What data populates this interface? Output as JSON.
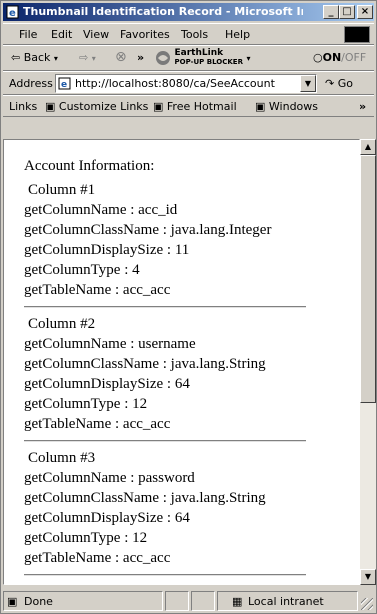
{
  "window": {
    "title": "Thumbnail Identification Record - Microsoft In...",
    "controls": [
      "_",
      "□",
      "×"
    ]
  },
  "menu": [
    "File",
    "Edit",
    "View",
    "Favorites",
    "Tools",
    "Help"
  ],
  "toolbar": {
    "back": "⇦ Back",
    "forward": "⇨",
    "stop": "⊗",
    "more": "»",
    "earthlink_top": "EarthLink",
    "earthlink_bottom": "POP-UP BLOCKER",
    "popup_status": "ON",
    "popup_status_off": "/OFF"
  },
  "address": {
    "label": "Address",
    "url": "http://localhost:8080/ca/SeeAccount",
    "go_label": "Go"
  },
  "links": {
    "label": "Links",
    "items": [
      "Customize Links",
      "Free Hotmail",
      "Windows"
    ],
    "more": "»"
  },
  "content": {
    "heading": "Account Information:",
    "columns": [
      {
        "title": "Column #1",
        "name": "getColumnName : acc_id",
        "class": "getColumnClassName : java.lang.Integer",
        "size": "getColumnDisplaySize : 11",
        "type": "getColumnType : 4",
        "table": "getTableName : acc_acc"
      },
      {
        "title": "Column #2",
        "name": "getColumnName : username",
        "class": "getColumnClassName : java.lang.String",
        "size": "getColumnDisplaySize : 64",
        "type": "getColumnType : 12",
        "table": "getTableName : acc_acc"
      },
      {
        "title": "Column #3",
        "name": "getColumnName : password",
        "class": "getColumnClassName : java.lang.String",
        "size": "getColumnDisplaySize : 64",
        "type": "getColumnType : 12",
        "table": "getTableName : acc_acc"
      }
    ]
  },
  "status": {
    "left": "Done",
    "zone": "Local intranet"
  }
}
